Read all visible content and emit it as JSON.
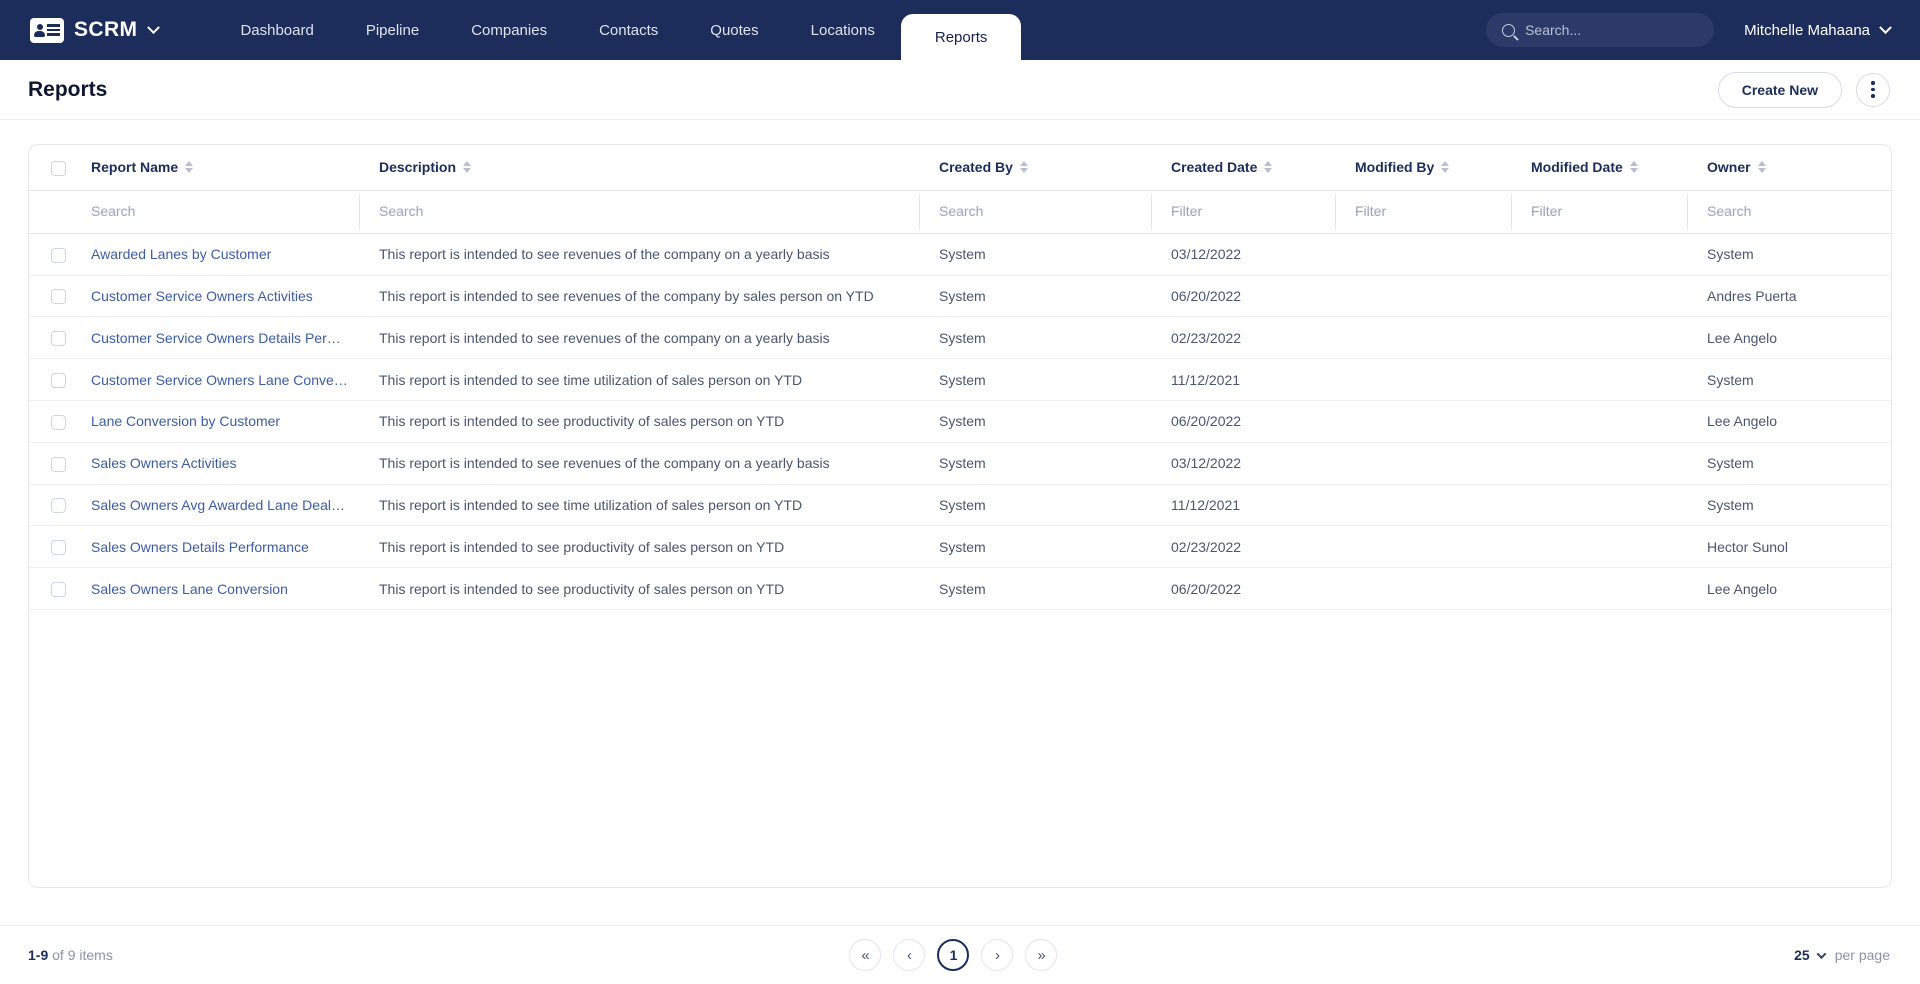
{
  "brand": {
    "name": "SCRM",
    "icon": "id-card-icon"
  },
  "nav": {
    "tabs": [
      {
        "label": "Dashboard",
        "active": false
      },
      {
        "label": "Pipeline",
        "active": false
      },
      {
        "label": "Companies",
        "active": false
      },
      {
        "label": "Contacts",
        "active": false
      },
      {
        "label": "Quotes",
        "active": false
      },
      {
        "label": "Locations",
        "active": false
      },
      {
        "label": "Reports",
        "active": true
      }
    ]
  },
  "search": {
    "placeholder": "Search...",
    "value": "",
    "icon": "search-icon"
  },
  "account": {
    "name": "Mitchelle Mahaana"
  },
  "page": {
    "title": "Reports",
    "create_label": "Create New",
    "more_icon": "kebab-menu-icon"
  },
  "table": {
    "columns": [
      {
        "key": "name",
        "label": "Report Name",
        "filter_placeholder": "Search"
      },
      {
        "key": "desc",
        "label": "Description",
        "filter_placeholder": "Search"
      },
      {
        "key": "cby",
        "label": "Created By",
        "filter_placeholder": "Search"
      },
      {
        "key": "cdt",
        "label": "Created Date",
        "filter_placeholder": "Filter"
      },
      {
        "key": "mby",
        "label": "Modified By",
        "filter_placeholder": "Filter"
      },
      {
        "key": "mdt",
        "label": "Modified Date",
        "filter_placeholder": "Filter"
      },
      {
        "key": "own",
        "label": "Owner",
        "filter_placeholder": "Search"
      }
    ],
    "rows": [
      {
        "name": "Awarded Lanes by Customer",
        "desc": "This report is intended to see revenues of the company on a yearly basis",
        "cby": "System",
        "cdt": "03/12/2022",
        "mby": "",
        "mdt": "",
        "own": "System"
      },
      {
        "name": "Customer Service Owners Activities",
        "desc": "This report is intended to see revenues of the company by sales person on YTD",
        "cby": "System",
        "cdt": "06/20/2022",
        "mby": "",
        "mdt": "",
        "own": "Andres Puerta"
      },
      {
        "name": "Customer Service Owners Details Per…",
        "desc": "This report is intended to see revenues of the company on a yearly basis",
        "cby": "System",
        "cdt": "02/23/2022",
        "mby": "",
        "mdt": "",
        "own": "Lee Angelo"
      },
      {
        "name": "Customer Service Owners Lane Conve…",
        "desc": "This report is intended to see time utilization of sales person on YTD",
        "cby": "System",
        "cdt": "11/12/2021",
        "mby": "",
        "mdt": "",
        "own": "System"
      },
      {
        "name": "Lane Conversion by Customer",
        "desc": "This report is intended to see productivity of sales person on YTD",
        "cby": "System",
        "cdt": "06/20/2022",
        "mby": "",
        "mdt": "",
        "own": "Lee Angelo"
      },
      {
        "name": "Sales Owners Activities",
        "desc": "This report is intended to see revenues of the company on a yearly basis",
        "cby": "System",
        "cdt": "03/12/2022",
        "mby": "",
        "mdt": "",
        "own": "System"
      },
      {
        "name": "Sales Owners Avg Awarded Lane Deal…",
        "desc": "This report is intended to see time utilization of sales person on YTD",
        "cby": "System",
        "cdt": "11/12/2021",
        "mby": "",
        "mdt": "",
        "own": "System"
      },
      {
        "name": "Sales Owners Details Performance",
        "desc": "This report is intended to see productivity of sales person on YTD",
        "cby": "System",
        "cdt": "02/23/2022",
        "mby": "",
        "mdt": "",
        "own": "Hector Sunol"
      },
      {
        "name": "Sales Owners Lane Conversion",
        "desc": "This report is intended to see productivity of sales person on YTD",
        "cby": "System",
        "cdt": "06/20/2022",
        "mby": "",
        "mdt": "",
        "own": "Lee Angelo"
      }
    ]
  },
  "footer": {
    "range": "1-9",
    "count_label": "of 9 items",
    "pager": [
      {
        "key": "first",
        "glyph": "«",
        "active": false
      },
      {
        "key": "prev",
        "glyph": "‹",
        "active": false
      },
      {
        "key": "page1",
        "glyph": "1",
        "active": true
      },
      {
        "key": "next",
        "glyph": "›",
        "active": false
      },
      {
        "key": "last",
        "glyph": "»",
        "active": false
      }
    ],
    "per_page_value": "25",
    "per_page_label": "per page"
  },
  "colors": {
    "nav_bg": "#1c2c5b",
    "accent": "#1c2c5b",
    "link": "#3c5ba8",
    "text": "#4b5570"
  }
}
